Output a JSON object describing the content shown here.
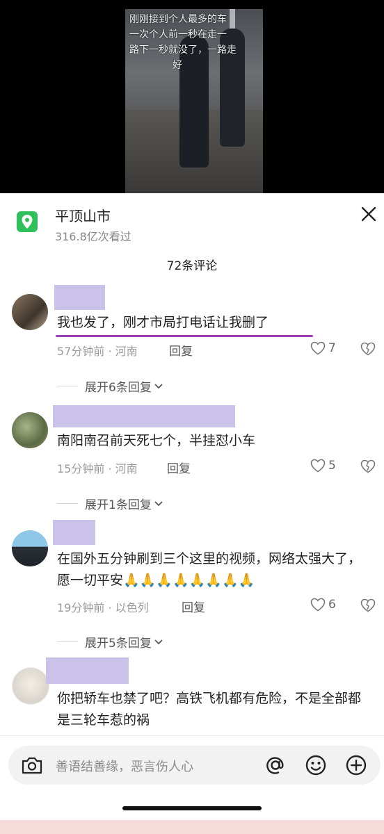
{
  "video": {
    "caption_lines": [
      "刚刚接到个人最多的车",
      "一次个人前一秒在走一",
      "路下一秒就没了，一路走",
      "好"
    ]
  },
  "header": {
    "location_title": "平顶山市",
    "views": "316.8亿次看过",
    "close_icon": "close-icon",
    "location_icon": "location-pin-icon"
  },
  "comments_count": "72条评论",
  "comments": [
    {
      "text": "我也发了，刚才市局打电话让我删了",
      "meta": "57分钟前 · 河南",
      "reply": "回复",
      "likes": "7",
      "expand": "展开6条回复"
    },
    {
      "text": "南阳南召前天死七个，半挂怼小车",
      "meta": "15分钟前 · 河南",
      "reply": "回复",
      "likes": "5",
      "expand": "展开1条回复"
    },
    {
      "text": "在国外五分钟刷到三个这里的视频，网络太强大了，愿一切平安🙏🙏🙏🙏🙏🙏🙏🙏",
      "meta": "19分钟前 · 以色列",
      "reply": "回复",
      "likes": "6",
      "expand": "展开5条回复"
    },
    {
      "text": "你把轿车也禁了吧？高铁飞机都有危险，不是全部都是三轮车惹的祸"
    }
  ],
  "input": {
    "placeholder": "善语结善缘，恶言伤人心",
    "icons": [
      "camera-icon",
      "at-icon",
      "emoji-icon",
      "plus-icon"
    ]
  },
  "colors": {
    "accent_green": "#2fbf5b",
    "redaction": "#cbc2ea",
    "underline": "#9c3fb3"
  }
}
